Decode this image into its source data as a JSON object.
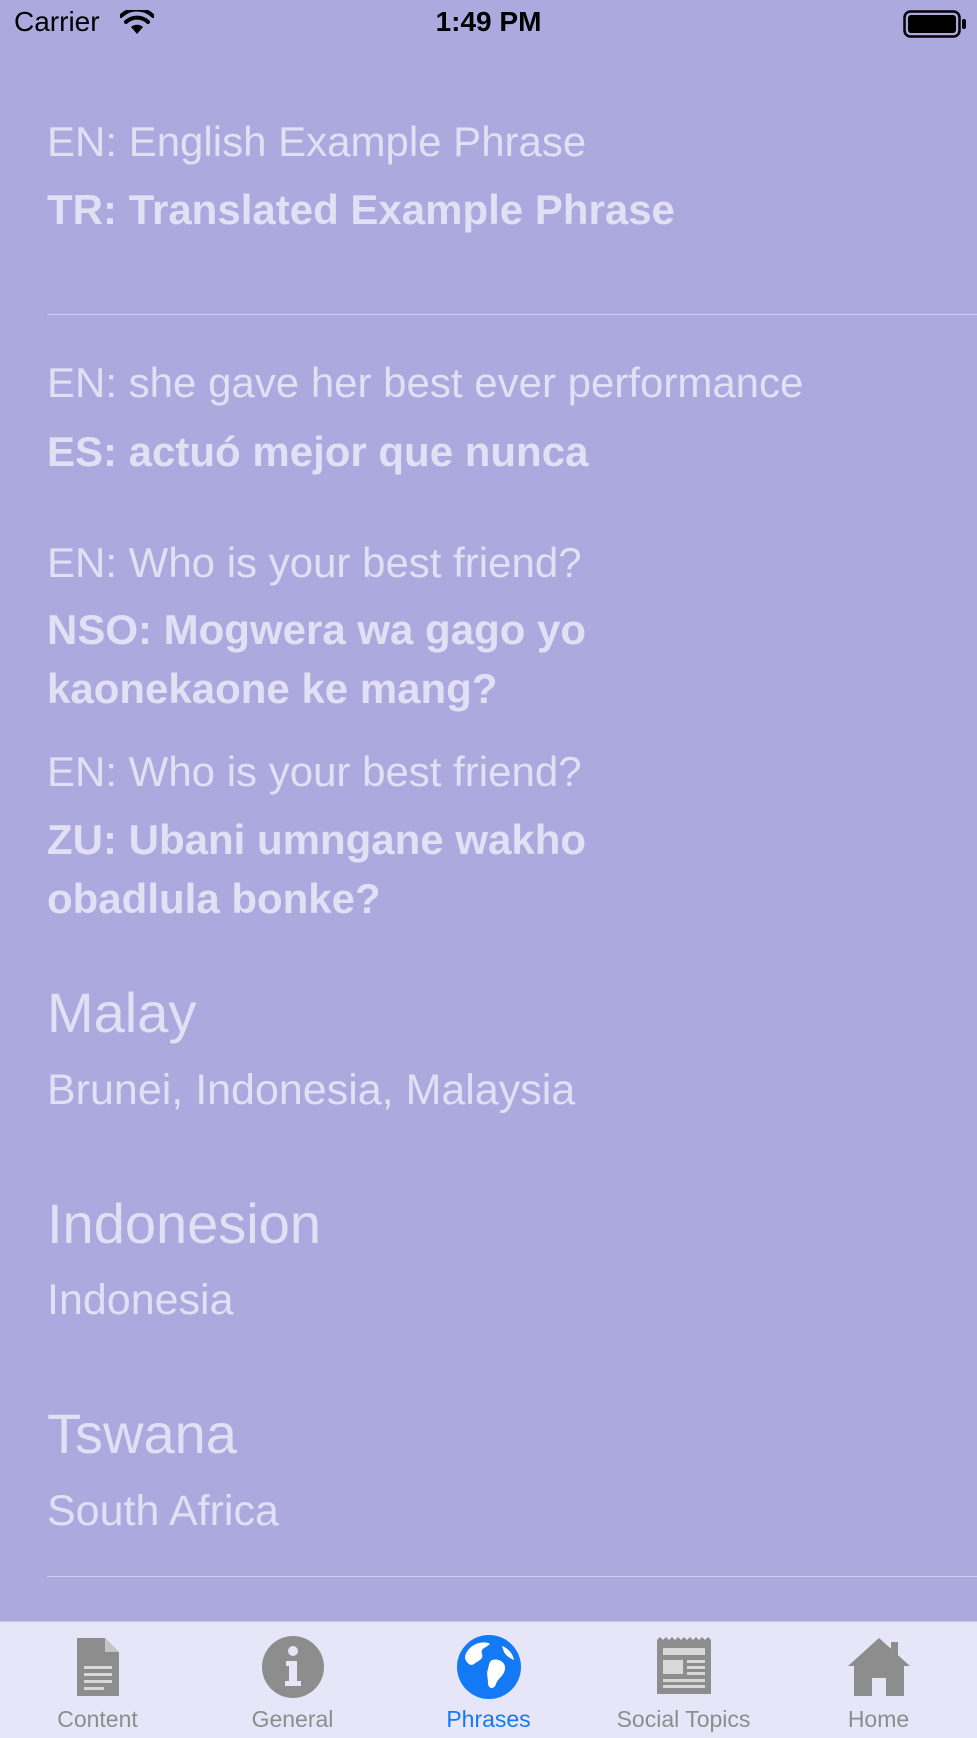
{
  "status_bar": {
    "carrier": "Carrier",
    "time": "1:49 PM"
  },
  "header_example": {
    "en": "EN: English Example Phrase",
    "tr": "TR: Translated Example Phrase"
  },
  "phrases": [
    {
      "en": "EN: she gave her best ever performance",
      "translation_lines": [
        "ES: actuó mejor que nunca"
      ]
    },
    {
      "en": "EN: Who is your best friend?",
      "translation_lines": [
        "NSO: Mogwera wa gago yo",
        "kaonekaone ke mang?"
      ]
    },
    {
      "en": "EN: Who is your best friend?",
      "translation_lines": [
        "ZU: Ubani umngane wakho",
        "obadlula bonke?"
      ]
    }
  ],
  "languages": [
    {
      "name": "Malay",
      "countries": "Brunei, Indonesia, Malaysia"
    },
    {
      "name": "Indonesion",
      "countries": "Indonesia"
    },
    {
      "name": "Tswana",
      "countries": "South Africa"
    }
  ],
  "tabs": [
    {
      "label": "Content",
      "icon": "document-icon",
      "active": false
    },
    {
      "label": "General",
      "icon": "info-icon",
      "active": false
    },
    {
      "label": "Phrases",
      "icon": "globe-icon",
      "active": true
    },
    {
      "label": "Social Topics",
      "icon": "newspaper-icon",
      "active": false
    },
    {
      "label": "Home",
      "icon": "home-icon",
      "active": false
    }
  ],
  "colors": {
    "background": "#aca9de",
    "text": "#e1e0f4",
    "tab_bar": "#e7e6f8",
    "tab_active": "#1379f5",
    "tab_inactive": "#8d8d8d"
  }
}
